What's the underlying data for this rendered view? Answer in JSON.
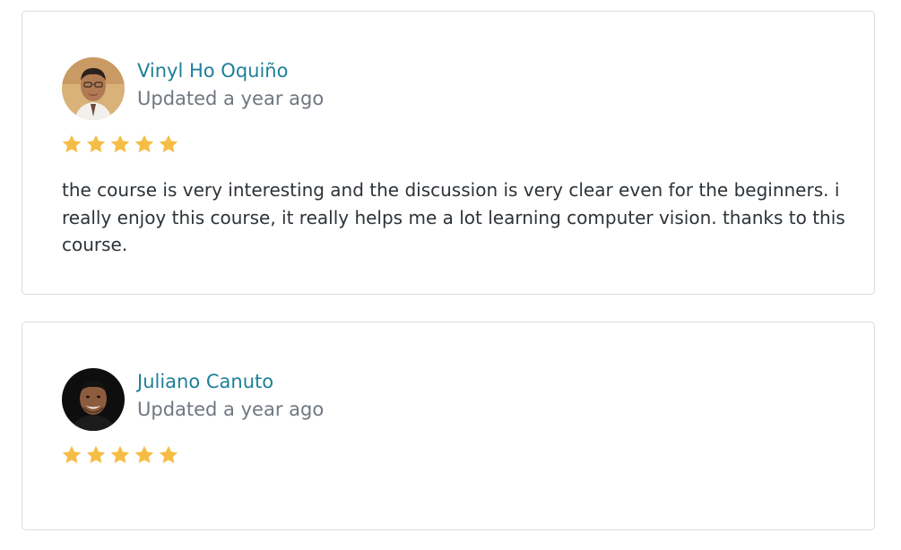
{
  "colors": {
    "author_link": "#1d7f99",
    "muted_text": "#6f7780",
    "body_text": "#2d3338",
    "star": "#f5bd45",
    "card_border": "#d9dde1"
  },
  "reviews": [
    {
      "author": "Vinyl Ho Oquiño",
      "updated": "Updated a year ago",
      "rating": 5,
      "rating_max": 5,
      "text": "the course is very interesting and the discussion is very clear even for the beginners. i really enjoy this course, it really helps me a lot learning computer vision. thanks to this course."
    },
    {
      "author": "Juliano Canuto",
      "updated": "Updated a year ago",
      "rating": 5,
      "rating_max": 5,
      "text": ""
    }
  ]
}
